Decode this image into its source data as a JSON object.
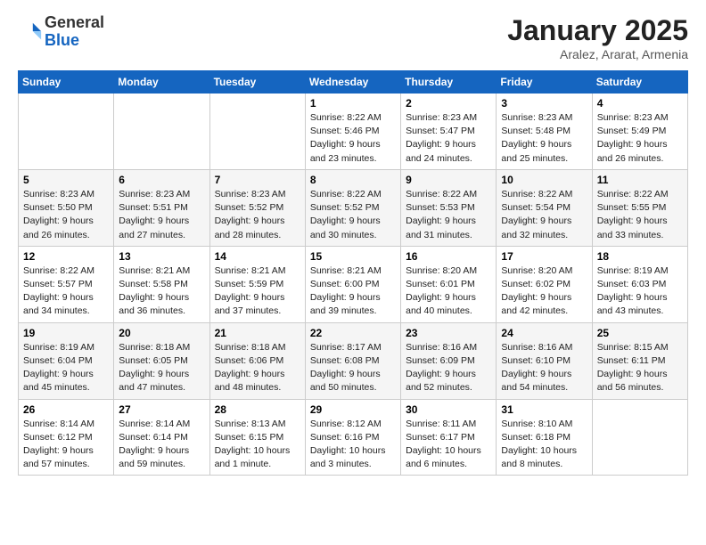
{
  "header": {
    "logo_general": "General",
    "logo_blue": "Blue",
    "month_title": "January 2025",
    "location": "Aralez, Ararat, Armenia"
  },
  "days_of_week": [
    "Sunday",
    "Monday",
    "Tuesday",
    "Wednesday",
    "Thursday",
    "Friday",
    "Saturday"
  ],
  "weeks": [
    [
      {
        "day": "",
        "info": ""
      },
      {
        "day": "",
        "info": ""
      },
      {
        "day": "",
        "info": ""
      },
      {
        "day": "1",
        "info": "Sunrise: 8:22 AM\nSunset: 5:46 PM\nDaylight: 9 hours and 23 minutes."
      },
      {
        "day": "2",
        "info": "Sunrise: 8:23 AM\nSunset: 5:47 PM\nDaylight: 9 hours and 24 minutes."
      },
      {
        "day": "3",
        "info": "Sunrise: 8:23 AM\nSunset: 5:48 PM\nDaylight: 9 hours and 25 minutes."
      },
      {
        "day": "4",
        "info": "Sunrise: 8:23 AM\nSunset: 5:49 PM\nDaylight: 9 hours and 26 minutes."
      }
    ],
    [
      {
        "day": "5",
        "info": "Sunrise: 8:23 AM\nSunset: 5:50 PM\nDaylight: 9 hours and 26 minutes."
      },
      {
        "day": "6",
        "info": "Sunrise: 8:23 AM\nSunset: 5:51 PM\nDaylight: 9 hours and 27 minutes."
      },
      {
        "day": "7",
        "info": "Sunrise: 8:23 AM\nSunset: 5:52 PM\nDaylight: 9 hours and 28 minutes."
      },
      {
        "day": "8",
        "info": "Sunrise: 8:22 AM\nSunset: 5:52 PM\nDaylight: 9 hours and 30 minutes."
      },
      {
        "day": "9",
        "info": "Sunrise: 8:22 AM\nSunset: 5:53 PM\nDaylight: 9 hours and 31 minutes."
      },
      {
        "day": "10",
        "info": "Sunrise: 8:22 AM\nSunset: 5:54 PM\nDaylight: 9 hours and 32 minutes."
      },
      {
        "day": "11",
        "info": "Sunrise: 8:22 AM\nSunset: 5:55 PM\nDaylight: 9 hours and 33 minutes."
      }
    ],
    [
      {
        "day": "12",
        "info": "Sunrise: 8:22 AM\nSunset: 5:57 PM\nDaylight: 9 hours and 34 minutes."
      },
      {
        "day": "13",
        "info": "Sunrise: 8:21 AM\nSunset: 5:58 PM\nDaylight: 9 hours and 36 minutes."
      },
      {
        "day": "14",
        "info": "Sunrise: 8:21 AM\nSunset: 5:59 PM\nDaylight: 9 hours and 37 minutes."
      },
      {
        "day": "15",
        "info": "Sunrise: 8:21 AM\nSunset: 6:00 PM\nDaylight: 9 hours and 39 minutes."
      },
      {
        "day": "16",
        "info": "Sunrise: 8:20 AM\nSunset: 6:01 PM\nDaylight: 9 hours and 40 minutes."
      },
      {
        "day": "17",
        "info": "Sunrise: 8:20 AM\nSunset: 6:02 PM\nDaylight: 9 hours and 42 minutes."
      },
      {
        "day": "18",
        "info": "Sunrise: 8:19 AM\nSunset: 6:03 PM\nDaylight: 9 hours and 43 minutes."
      }
    ],
    [
      {
        "day": "19",
        "info": "Sunrise: 8:19 AM\nSunset: 6:04 PM\nDaylight: 9 hours and 45 minutes."
      },
      {
        "day": "20",
        "info": "Sunrise: 8:18 AM\nSunset: 6:05 PM\nDaylight: 9 hours and 47 minutes."
      },
      {
        "day": "21",
        "info": "Sunrise: 8:18 AM\nSunset: 6:06 PM\nDaylight: 9 hours and 48 minutes."
      },
      {
        "day": "22",
        "info": "Sunrise: 8:17 AM\nSunset: 6:08 PM\nDaylight: 9 hours and 50 minutes."
      },
      {
        "day": "23",
        "info": "Sunrise: 8:16 AM\nSunset: 6:09 PM\nDaylight: 9 hours and 52 minutes."
      },
      {
        "day": "24",
        "info": "Sunrise: 8:16 AM\nSunset: 6:10 PM\nDaylight: 9 hours and 54 minutes."
      },
      {
        "day": "25",
        "info": "Sunrise: 8:15 AM\nSunset: 6:11 PM\nDaylight: 9 hours and 56 minutes."
      }
    ],
    [
      {
        "day": "26",
        "info": "Sunrise: 8:14 AM\nSunset: 6:12 PM\nDaylight: 9 hours and 57 minutes."
      },
      {
        "day": "27",
        "info": "Sunrise: 8:14 AM\nSunset: 6:14 PM\nDaylight: 9 hours and 59 minutes."
      },
      {
        "day": "28",
        "info": "Sunrise: 8:13 AM\nSunset: 6:15 PM\nDaylight: 10 hours and 1 minute."
      },
      {
        "day": "29",
        "info": "Sunrise: 8:12 AM\nSunset: 6:16 PM\nDaylight: 10 hours and 3 minutes."
      },
      {
        "day": "30",
        "info": "Sunrise: 8:11 AM\nSunset: 6:17 PM\nDaylight: 10 hours and 6 minutes."
      },
      {
        "day": "31",
        "info": "Sunrise: 8:10 AM\nSunset: 6:18 PM\nDaylight: 10 hours and 8 minutes."
      },
      {
        "day": "",
        "info": ""
      }
    ]
  ]
}
